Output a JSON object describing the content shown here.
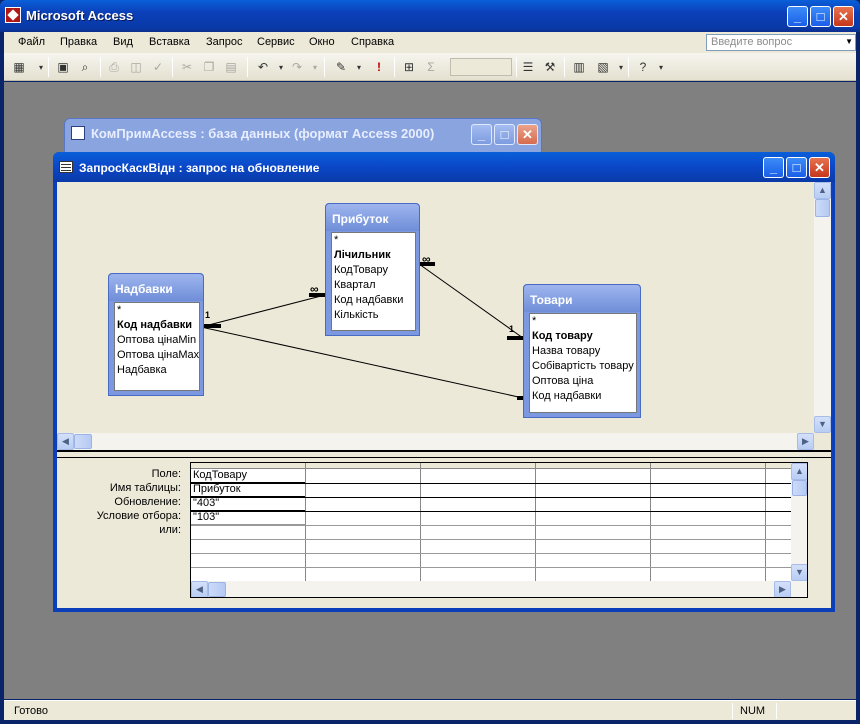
{
  "app": {
    "title": "Microsoft Access",
    "menu": [
      "Файл",
      "Правка",
      "Вид",
      "Вставка",
      "Запрос",
      "Сервис",
      "Окно",
      "Справка"
    ],
    "help_placeholder": "Введите вопрос",
    "toolbar_icons": [
      "datasheet-view-icon",
      "save-icon",
      "search-icon",
      "print-icon",
      "print-preview-icon",
      "spelling-icon",
      "cut-icon",
      "copy-icon",
      "paste-icon",
      "undo-icon",
      "redo-icon",
      "query-type-icon",
      "run-icon",
      "show-table-icon",
      "totals-icon",
      "top-values-combo",
      "properties-icon",
      "build-icon",
      "database-window-icon",
      "new-object-icon",
      "help-icon"
    ],
    "status": "Готово",
    "num": "NUM"
  },
  "db_window": {
    "title": "КомПримAccess : база данных (формат Access 2000)"
  },
  "query_window": {
    "title": "ЗапросКаскВідн : запрос на обновление",
    "tables": [
      {
        "name": "Надбавки",
        "fields": [
          {
            "label": "*",
            "pk": false
          },
          {
            "label": "Код надбавки",
            "pk": true
          },
          {
            "label": "Оптова цінаMin",
            "pk": false
          },
          {
            "label": "Оптова цінаMax",
            "pk": false
          },
          {
            "label": "Надбавка",
            "pk": false
          }
        ]
      },
      {
        "name": "Прибуток",
        "fields": [
          {
            "label": "*",
            "pk": false
          },
          {
            "label": "Лічильник",
            "pk": true
          },
          {
            "label": "КодТовару",
            "pk": false
          },
          {
            "label": "Квартал",
            "pk": false
          },
          {
            "label": "Код надбавки",
            "pk": false
          },
          {
            "label": "Кількість",
            "pk": false
          }
        ]
      },
      {
        "name": "Товари",
        "fields": [
          {
            "label": "*",
            "pk": false
          },
          {
            "label": "Код товару",
            "pk": true
          },
          {
            "label": "Назва товару",
            "pk": false
          },
          {
            "label": "Собівартість товару",
            "pk": false
          },
          {
            "label": "Оптова ціна",
            "pk": false
          },
          {
            "label": "Код надбавки",
            "pk": false
          }
        ]
      }
    ],
    "relations": {
      "one": "1",
      "many": "∞"
    },
    "grid": {
      "row_labels": [
        "Поле:",
        "Имя таблицы:",
        "Обновление:",
        "Условие отбора:",
        "или:"
      ],
      "col1": [
        "КодТовару",
        "Прибуток",
        "\"403\"",
        "\"103\"",
        ""
      ]
    }
  }
}
